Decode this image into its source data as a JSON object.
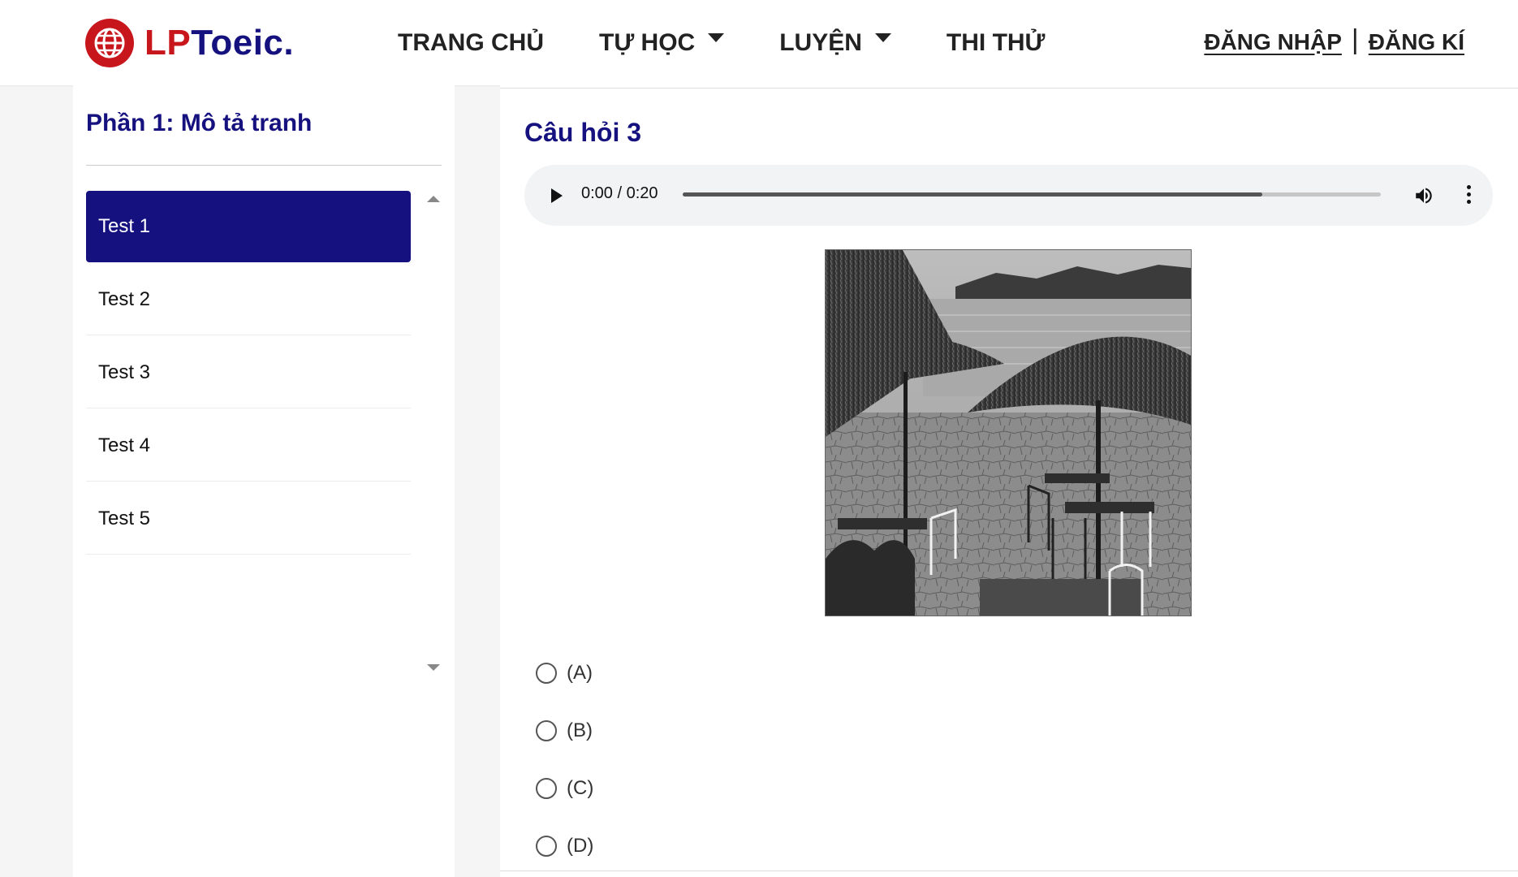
{
  "brand": {
    "lp": "LP",
    "toeic": "Toeic."
  },
  "nav": [
    {
      "label": "TRANG CHỦ",
      "dropdown": false
    },
    {
      "label": "TỰ HỌC",
      "dropdown": true
    },
    {
      "label": "LUYỆN",
      "dropdown": true
    },
    {
      "label": "THI THỬ",
      "dropdown": false
    }
  ],
  "auth": {
    "login": "ĐĂNG NHẬP",
    "separator": "|",
    "register": "ĐĂNG KÍ"
  },
  "sidebar": {
    "title": "Phần 1: Mô tả tranh",
    "tests": [
      "Test 1",
      "Test 2",
      "Test 3",
      "Test 4",
      "Test 5"
    ],
    "active_index": 0
  },
  "question": {
    "title": "Câu hỏi 3",
    "audio": {
      "time": "0:00 / 0:20",
      "progress": 0.83
    },
    "options": [
      "(A)",
      "(B)",
      "(C)",
      "(D)"
    ]
  },
  "colors": {
    "brand_red": "#c8161d",
    "brand_navy": "#15117f"
  },
  "icons": [
    "globe-icon",
    "play-icon",
    "volume-icon",
    "more-vert-icon"
  ]
}
